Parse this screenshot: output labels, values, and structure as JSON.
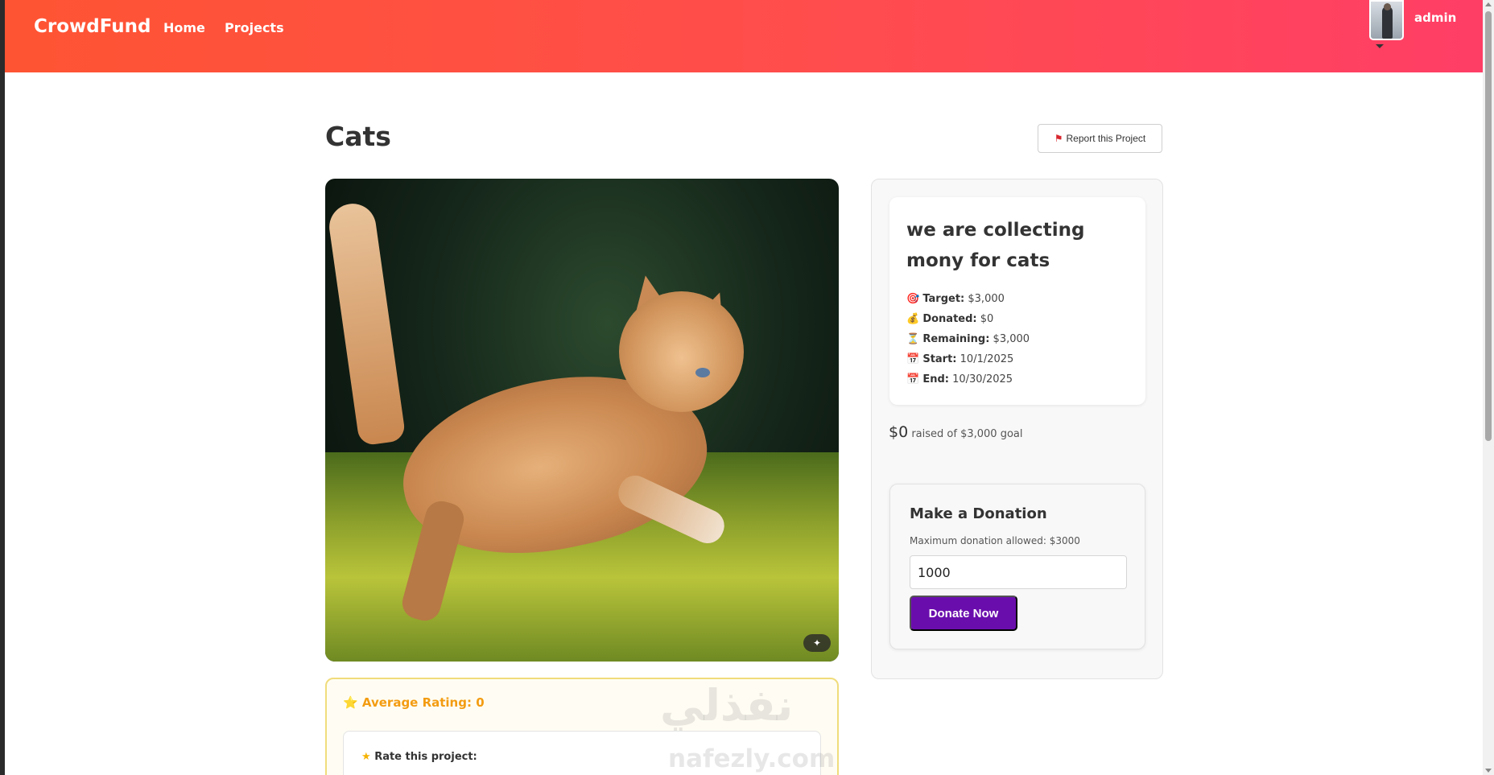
{
  "navbar": {
    "brand": "CrowdFund",
    "links": [
      {
        "label": "Home"
      },
      {
        "label": "Projects"
      }
    ],
    "user": {
      "name": "admin"
    }
  },
  "project": {
    "title": "Cats",
    "report_label": "Report this Project",
    "report_icon": "flag-icon"
  },
  "rating": {
    "average_label": "⭐ Average Rating: 0",
    "rate_label": "Rate this project:"
  },
  "info": {
    "headline": "we are collecting mony for cats",
    "lines": [
      {
        "icon": "🎯",
        "label": "Target:",
        "value": "$3,000"
      },
      {
        "icon": "💰",
        "label": "Donated:",
        "value": "$0"
      },
      {
        "icon": "⏳",
        "label": "Remaining:",
        "value": "$3,000"
      },
      {
        "icon": "📅",
        "label": "Start:",
        "value": "10/1/2025"
      },
      {
        "icon": "📅",
        "label": "End:",
        "value": "10/30/2025"
      }
    ],
    "raised_amount": "$0",
    "raised_text": "raised of $3,000 goal"
  },
  "donation": {
    "title": "Make a Donation",
    "max_text": "Maximum donation allowed: $3000",
    "amount_value": "1000",
    "button_label": "Donate Now"
  },
  "watermark": {
    "arabic": "نفذلي",
    "latin": "nafezly.com"
  },
  "colors": {
    "nav_start": "#ff5433",
    "nav_end": "#ff3e66",
    "donate_button": "#6a0dad",
    "rating_accent": "#f39c12"
  }
}
